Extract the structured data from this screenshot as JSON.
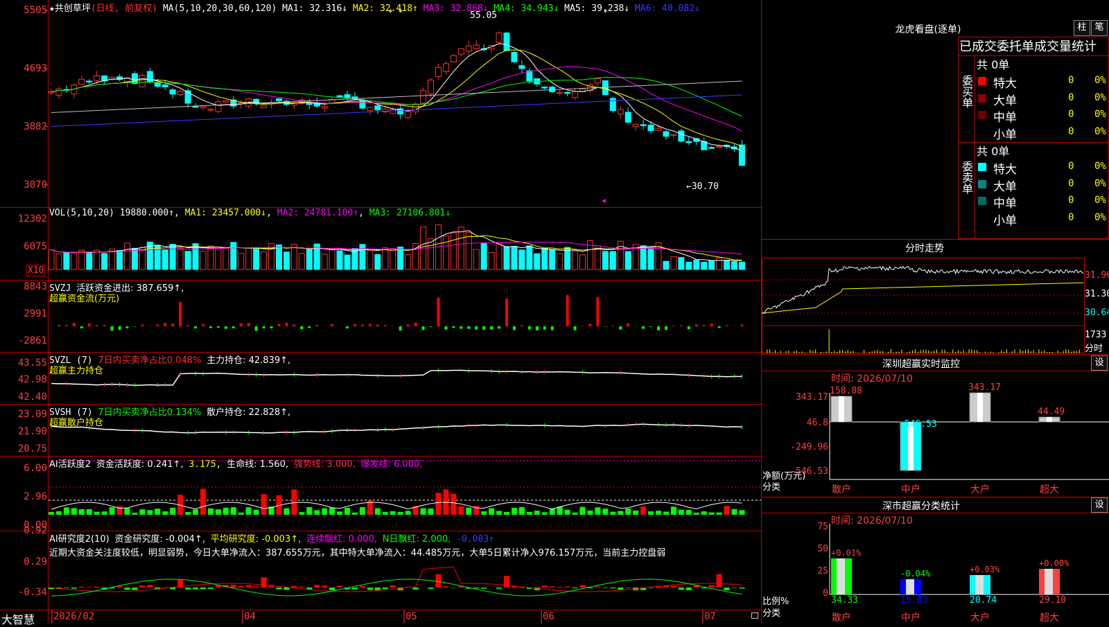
{
  "chart_data": [
    {
      "type": "candlestick",
      "title": "★共创草坪(日线,前复权)",
      "ylim": [
        2900,
        5600
      ],
      "y_ticks": [
        "5505",
        "4693",
        "3882",
        "3070"
      ],
      "annotations": [
        "55.05",
        "←30.70"
      ],
      "x_labels": [
        "2026/02",
        "04",
        "05",
        "06",
        "07"
      ],
      "ma_labels": [
        "MA(5,10,20,30,60,120)",
        "MA1: 32.316↓",
        "MA2: 32.418↑",
        "MA3: 32.868↓",
        "MA4: 34.943↓",
        "MA5: 39.238↓",
        "MA6: 40.082↓"
      ],
      "ma_colors": [
        "#ffffff",
        "#ffff00",
        "#ff00ff",
        "#00ff00",
        "#c0c0c0",
        "#3a3aff"
      ]
    },
    {
      "type": "bar",
      "title": "VOL(5,10,20) 19880.000↑",
      "y_ticks": [
        "12302",
        "6075"
      ],
      "scale_label": "X10",
      "ma_labels": [
        "MA1: 23457.000↓",
        "MA2: 24781.100↑",
        "MA3: 27106.801↓"
      ]
    },
    {
      "type": "bar",
      "title": "SVZJ 活跃资金进出: 387.659↑,",
      "subtitle": "超赢资金流(万元)",
      "y_ticks": [
        "8843",
        "2991",
        "-2861"
      ]
    },
    {
      "type": "line",
      "title": "SVZL (7) 7日内买卖净占比0.048% 主力持仓: 42.839↑,",
      "subtitle": "超赢主力持仓",
      "y_ticks": [
        "43.55",
        "42.98",
        "42.40"
      ]
    },
    {
      "type": "line",
      "title": "SVSH (7) 7日内买卖净占比0.134% 散户持仓: 22.828↑,",
      "subtitle": "超赢散户持仓",
      "y_ticks": [
        "23.09",
        "21.90",
        "20.75"
      ]
    },
    {
      "type": "bar",
      "title": "AI活跃度2 资金活跃度: 0.241↑, 3.175, 生命线: 1.560, 强势线: 3.000, 爆发线: 6.000,",
      "y_ticks": [
        "6.00",
        "2.96",
        "0.00"
      ]
    },
    {
      "type": "bar",
      "title": "AI研究度2(10) 资金研究度: -0.004↑, 平均研究度: -0.003↑, 连续飘红: 0.000, N日飘红: 2.000, -0.003↑",
      "y_ticks": [
        "0.92",
        "0.29",
        "-0.34"
      ]
    },
    {
      "type": "bar",
      "title": "深圳超赢实时监控",
      "time": "时间: 2026/07/10",
      "categories": [
        "散户",
        "中户",
        "大户",
        "超大"
      ],
      "values": [
        158.88,
        -546.53,
        343.17,
        44.49
      ],
      "y_ticks": [
        "343.17",
        "46.8",
        "-249.96",
        "-546.53"
      ],
      "ylabel": "净额(万元)",
      "xlabel": "分类"
    },
    {
      "type": "bar",
      "title": "深市超赢分类统计",
      "time": "时间: 2026/07/10",
      "categories": [
        "散户",
        "中户",
        "大户",
        "超大"
      ],
      "values": [
        34.33,
        15.83,
        20.74,
        29.1
      ],
      "changes": [
        "+0.01%",
        "-0.04%",
        "+0.03%",
        "+0.00%"
      ],
      "y_ticks": [
        "75",
        "50",
        "25",
        "0"
      ],
      "ylabel": "比例%",
      "xlabel": "分类"
    }
  ],
  "main": {
    "header": {
      "name": "★共创草坪",
      "mode": "(日线, 前复权)",
      "ma": "MA(5,10,20,30,60,120)",
      "ma1": "MA1: 32.316↓",
      "ma2": "MA2: 32.418↑",
      "ma3": "MA3: 32.868↓",
      "ma4": "MA4: 34.943↓",
      "ma5": "MA5: 39.238↓",
      "ma6": "MA6: 40.082↓"
    },
    "y": [
      "5505",
      "4693",
      "3882",
      "3070"
    ],
    "high_label": "55.05",
    "low_label": "←30.70"
  },
  "vol": {
    "name": "VOL(5,10,20)",
    "val": "19880.000↑",
    "ma1": "MA1: 23457.000↓",
    "ma2": "MA2: 24781.100↑",
    "ma3": "MA3: 27106.801↓",
    "y": [
      "12302",
      "6075"
    ],
    "x10": "X10"
  },
  "svzj": {
    "name": "SVZJ",
    "text": "活跃资金进出: 387.659↑,",
    "sub": "超赢资金流(万元)",
    "y": [
      "8843",
      "2991",
      "-2861"
    ]
  },
  "svzl": {
    "name": "SVZL",
    "p": "(7)",
    "t1": "7日内买卖净占比0.048%",
    "t2": "主力持仓: 42.839↑,",
    "sub": "超赢主力持仓",
    "y": [
      "43.55",
      "42.98",
      "42.40"
    ]
  },
  "svsh": {
    "name": "SVSH",
    "p": "(7)",
    "t1": "7日内买卖净占比0.134%",
    "t2": "散户持仓: 22.828↑,",
    "sub": "超赢散户持仓",
    "y": [
      "23.09",
      "21.90",
      "20.75"
    ]
  },
  "ai1": {
    "name": "AI活跃度2",
    "t1": "资金活跃度: 0.241↑,",
    "t2": "3.175,",
    "t3": "生命线: 1.560,",
    "t4": "强势线: 3.000,",
    "t5": "爆发线: 6.000,",
    "y": [
      "6.00",
      "2.96",
      "0.00"
    ]
  },
  "ai2": {
    "name": "AI研究度2(10)",
    "t1": "资金研究度: -0.004↑,",
    "t2": "平均研究度: -0.003↑,",
    "t3": "连续飘红: 0.000,",
    "t4": "N日飘红: 2.000,",
    "t5": "-0.003↑",
    "y": [
      "0.92",
      "0.29",
      "-0.34"
    ],
    "comment": "近期大资金关注度较低，明显弱势，今日大单净流入：387.655万元，其中特大单净流入：44.485万元，大单5日累计净入976.157万元，当前主力控盘弱"
  },
  "xaxis": {
    "logo": "大智慧",
    "labels": [
      "2026/02",
      "04",
      "05",
      "06",
      "07"
    ]
  },
  "right": {
    "title": "龙虎看盘(逐单)",
    "btn_col": "柱",
    "btn_pen": "笔",
    "stats_title": "已成交委托单成交量统计",
    "buy_side": "委买单",
    "sell_side": "委卖单",
    "buy_total": "共 0单",
    "sell_total": "共 0单",
    "rows": [
      "特大",
      "大单",
      "中单",
      "小单"
    ],
    "zero": "0",
    "pct": "0%",
    "intraday_title": "分时走势",
    "intraday_y": [
      "31.96",
      "31.30",
      "30.64"
    ],
    "intraday_vol": "1733",
    "intraday_vol2": "分时",
    "monitor_title": "深圳超赢实时监控",
    "monitor_set": "设",
    "monitor_time": "时间: 2026/07/10",
    "monitor_y": [
      "343.17",
      "46.8",
      "-249.96",
      "-546.53"
    ],
    "monitor_vals": [
      "158.88",
      "-546.53",
      "343.17",
      "44.49"
    ],
    "monitor_ylabel": "净额(万元)",
    "monitor_xlabel": "分类",
    "cats": [
      "散户",
      "中户",
      "大户",
      "超大"
    ],
    "class_title": "深市超赢分类统计",
    "class_set": "设",
    "class_time": "时间: 2026/07/10",
    "class_y": [
      "75",
      "50",
      "25",
      "0"
    ],
    "class_pct": [
      "+0.01%",
      "-0.04%",
      "+0.03%",
      "+0.00%"
    ],
    "class_vals": [
      "34.33",
      "15.83",
      "20.74",
      "29.10"
    ],
    "class_ylabel": "比例%",
    "class_xlabel": "分类"
  }
}
